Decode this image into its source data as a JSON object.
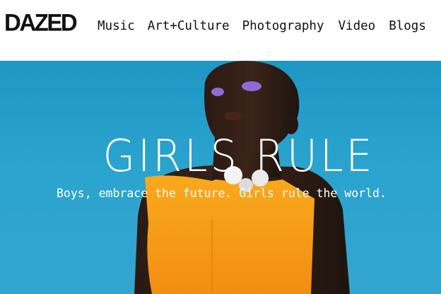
{
  "brand": {
    "logo_text": "DAZED"
  },
  "nav": {
    "items": [
      {
        "label": "Music"
      },
      {
        "label": "Art+Culture"
      },
      {
        "label": "Photography"
      },
      {
        "label": "Video"
      },
      {
        "label": "Blogs"
      }
    ]
  },
  "hero": {
    "title": "GIRLS RULE",
    "subtitle": "Boys, embrace the future. Girls rule the world."
  },
  "colors": {
    "sky": "#2aa3cf",
    "dress": "#f7a21a",
    "text_dark": "#111111",
    "text_light": "#ffffff"
  }
}
